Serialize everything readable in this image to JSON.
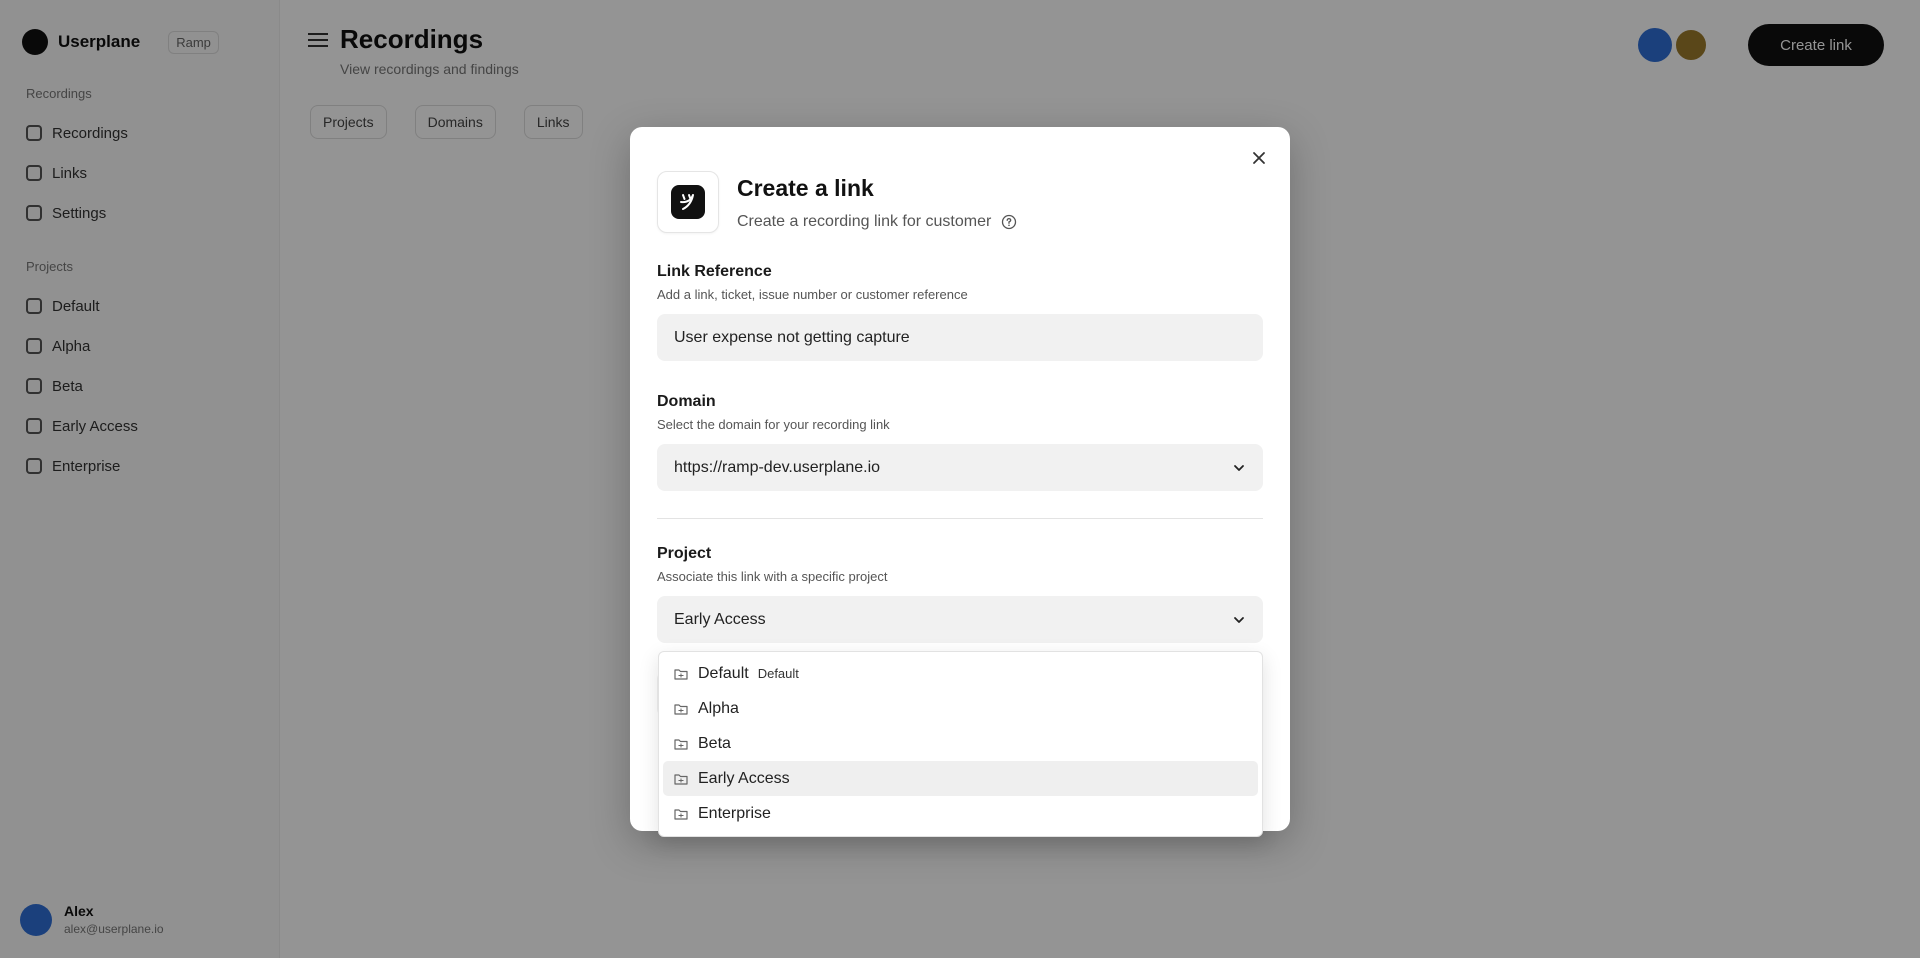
{
  "background": {
    "brand": {
      "name": "Userplane",
      "badge": "Ramp"
    },
    "nav_sections": [
      {
        "heading": "Recordings",
        "items": [
          "Recordings",
          "Links",
          "Settings"
        ]
      },
      {
        "heading": "Projects",
        "items": [
          "Default",
          "Alpha",
          "Beta",
          "Early Access",
          "Enterprise"
        ]
      }
    ],
    "user": {
      "name": "Alex",
      "email": "alex@userplane.io"
    },
    "page": {
      "title": "Recordings",
      "subtitle": "View recordings and findings"
    },
    "filters": [
      "Projects",
      "Domains",
      "Links"
    ],
    "share_label": "Create link"
  },
  "modal": {
    "title": "Create a link",
    "subtitle": "Create a recording link for customer",
    "close_icon": "close-icon",
    "link_reference": {
      "label": "Link Reference",
      "description": "Add a link, ticket, issue number or customer reference",
      "value": "User expense not getting capture"
    },
    "domain": {
      "label": "Domain",
      "description": "Select the domain for your recording link",
      "value": "https://ramp-dev.userplane.io"
    },
    "project": {
      "label": "Project",
      "description": "Associate this link with a specific project",
      "value": "Early Access"
    }
  },
  "dropdown": {
    "options": [
      {
        "label": "Default",
        "badge": "Default",
        "selected": false
      },
      {
        "label": "Alpha",
        "badge": "",
        "selected": false
      },
      {
        "label": "Beta",
        "badge": "",
        "selected": false
      },
      {
        "label": "Early Access",
        "badge": "",
        "selected": true
      },
      {
        "label": "Enterprise",
        "badge": "",
        "selected": false
      }
    ]
  },
  "colors": {
    "overlay": "#000000",
    "primary": "#111111",
    "field_bg": "#f1f1f1",
    "selected_bg": "#efefef"
  }
}
